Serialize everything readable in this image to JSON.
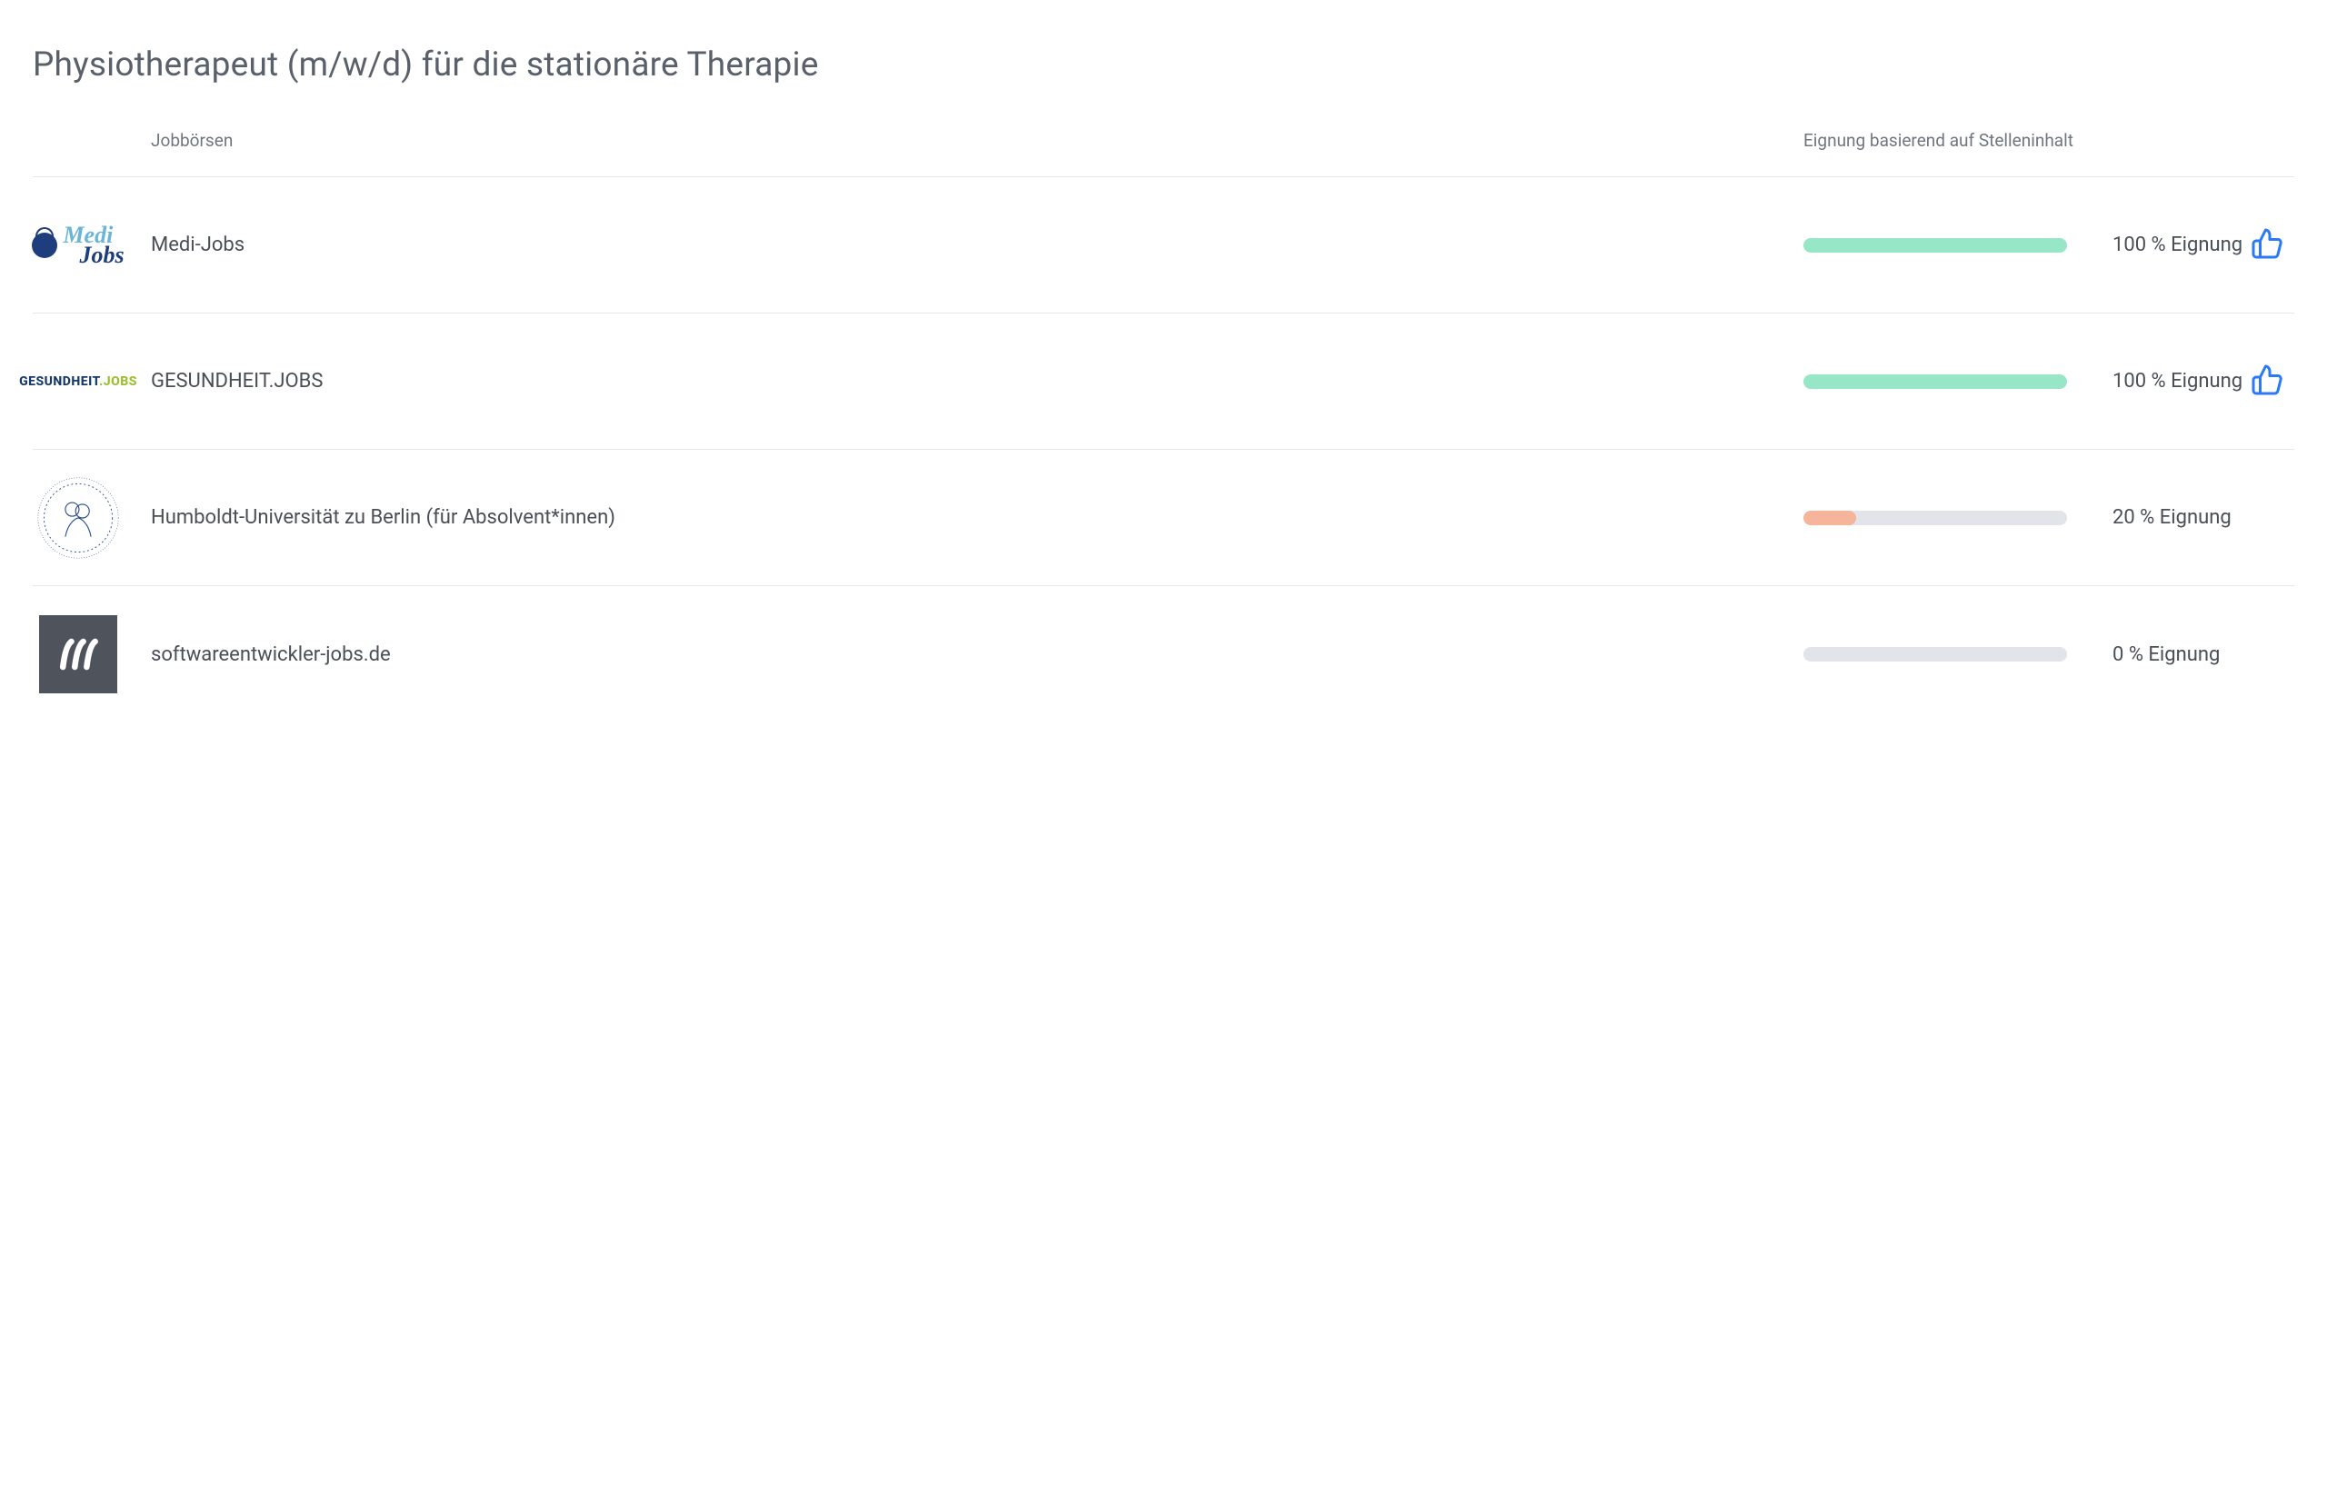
{
  "title": "Physiotherapeut (m/w/d) für die stationäre Therapie",
  "headers": {
    "jobboards": "Jobbörsen",
    "suitability": "Eignung basierend auf Stelleninhalt"
  },
  "suitability_suffix": " Eignung",
  "colors": {
    "bar_high": "#97e6c7",
    "bar_low": "#f6b49a",
    "bar_track": "#e1e4e8",
    "thumb": "#2a7af5"
  },
  "rows": [
    {
      "logo": "medi",
      "name": "Medi-Jobs",
      "percent": 100,
      "percent_text": "100 %",
      "bar_color_key": "bar_high",
      "thumbs_up": true
    },
    {
      "logo": "gesund",
      "name": "GESUNDHEIT.JOBS",
      "percent": 100,
      "percent_text": "100 %",
      "bar_color_key": "bar_high",
      "thumbs_up": true
    },
    {
      "logo": "hu",
      "name": "Humboldt-Universität zu Berlin (für Absolvent*innen)",
      "percent": 20,
      "percent_text": "20 %",
      "bar_color_key": "bar_low",
      "thumbs_up": false
    },
    {
      "logo": "se",
      "name": "softwareentwickler-jobs.de",
      "percent": 0,
      "percent_text": "0 %",
      "bar_color_key": "bar_track",
      "thumbs_up": false
    }
  ]
}
